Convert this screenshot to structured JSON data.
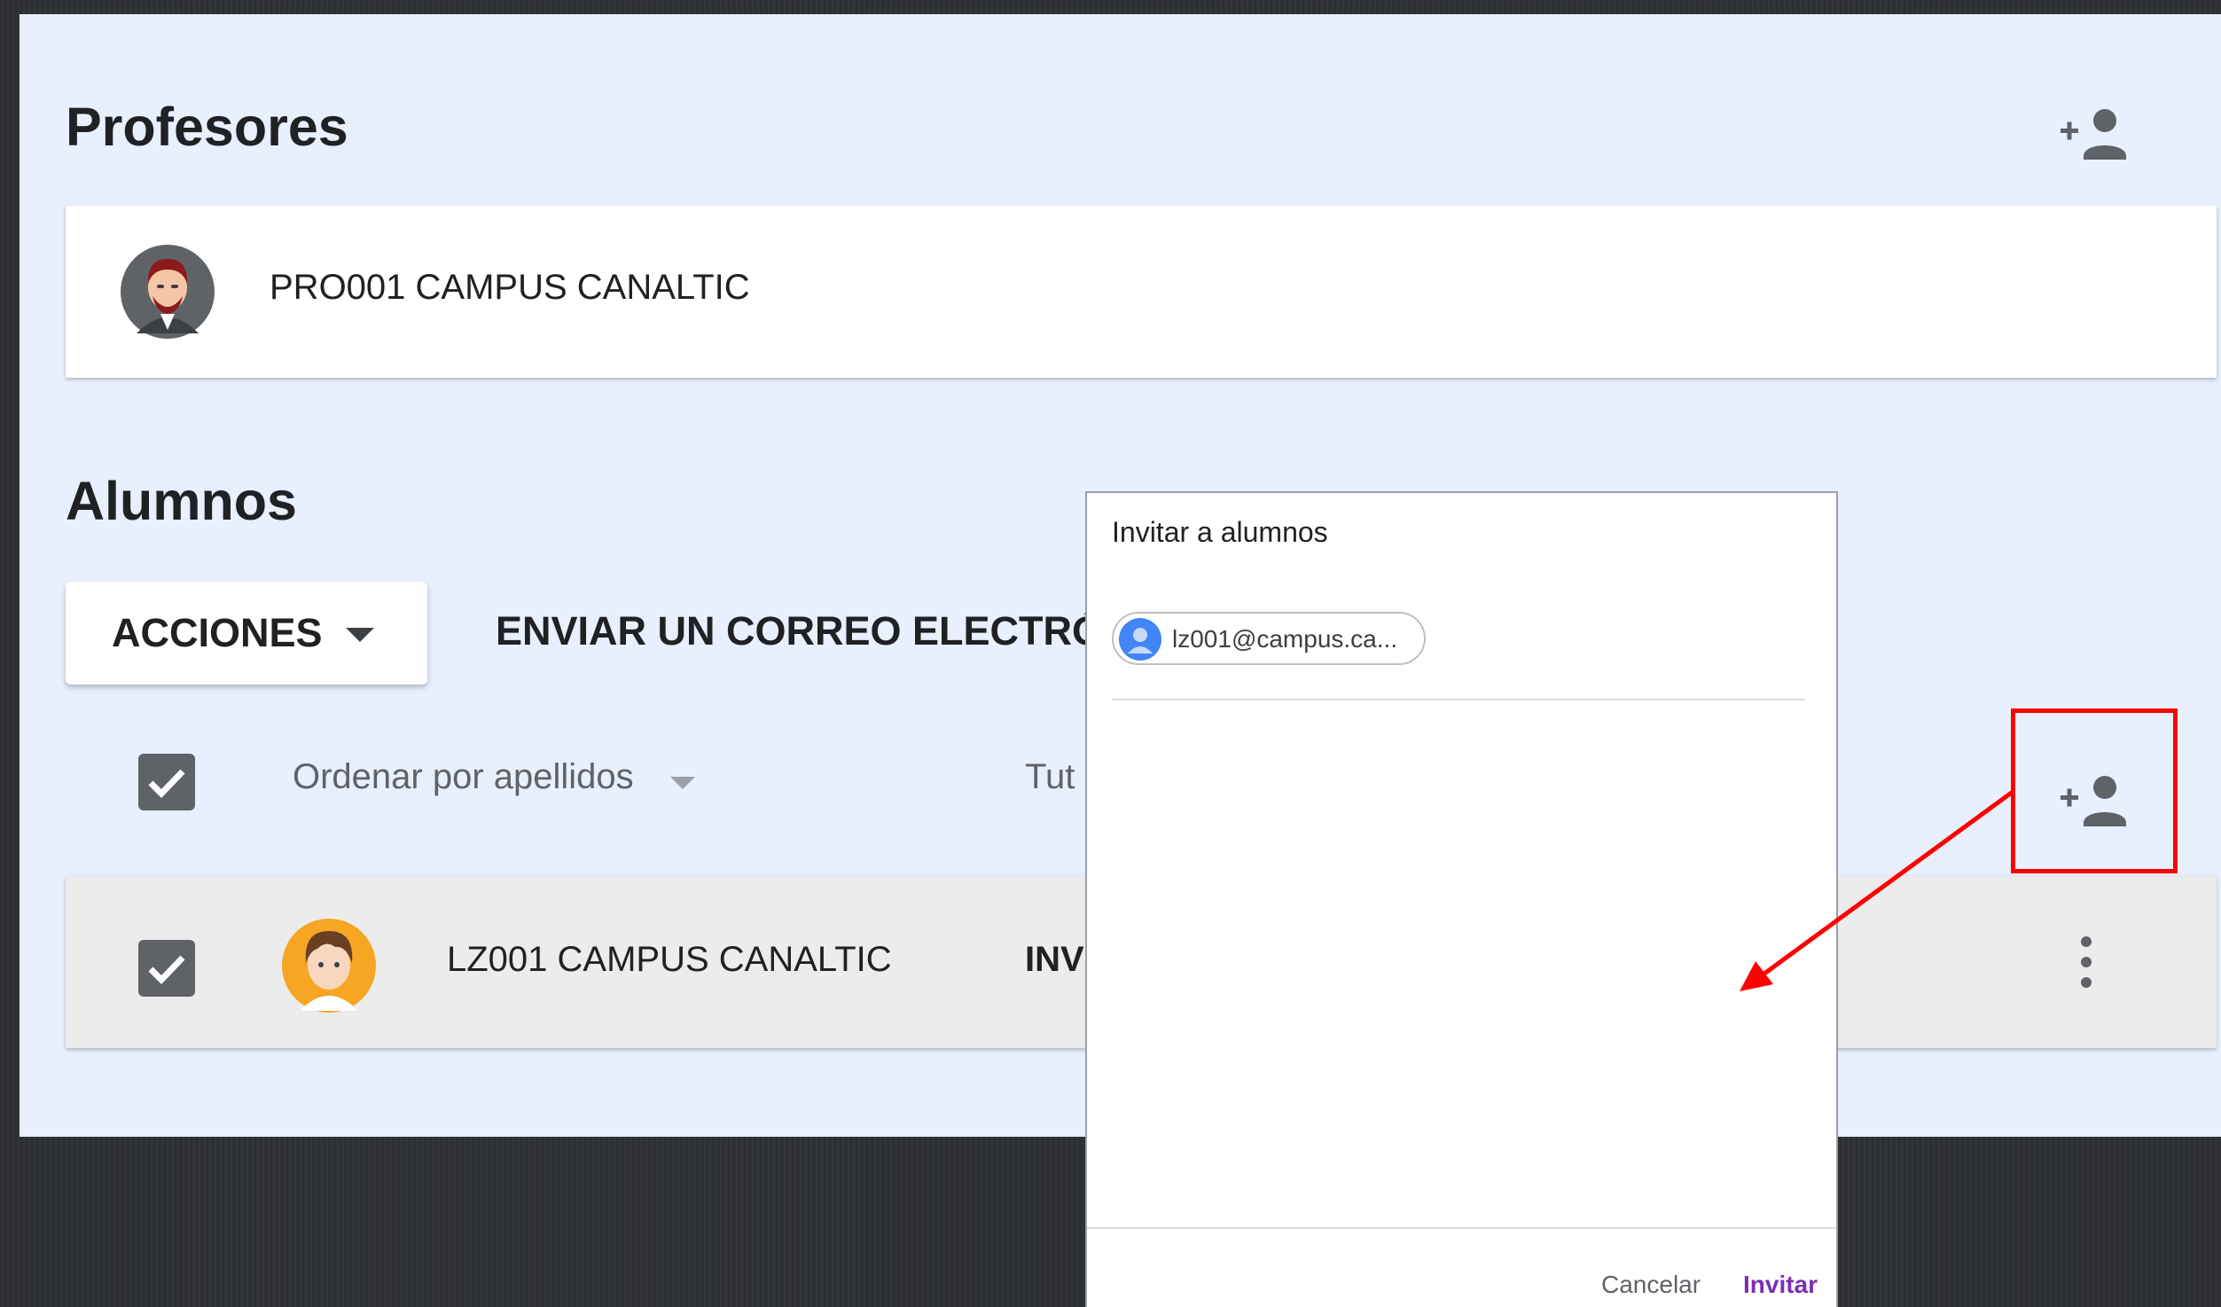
{
  "teachers": {
    "title": "Profesores",
    "add_icon": "add-person-icon",
    "items": [
      {
        "name": "PRO001 CAMPUS CANALTIC",
        "avatar": "teacher-avatar"
      }
    ]
  },
  "students": {
    "title": "Alumnos",
    "add_icon": "add-person-icon",
    "actions_label": "ACCIONES",
    "email_label": "ENVIAR UN CORREO ELECTRÓNI",
    "sort_label": "Ordenar por apellidos",
    "guardians_label": "Tut",
    "items": [
      {
        "name": "LZ001 CAMPUS CANALTIC",
        "status": "INV",
        "avatar": "student-avatar",
        "more_icon": "more-vert-icon"
      }
    ]
  },
  "dialog": {
    "title": "Invitar a alumnos",
    "chip_text": "lz001@campus.ca...",
    "cancel_label": "Cancelar",
    "invite_label": "Invitar"
  },
  "colors": {
    "panel": "#e8effd",
    "highlight": "#ff0000",
    "invite_button": "#7b2fb5",
    "chip_avatar": "#4285f4"
  }
}
